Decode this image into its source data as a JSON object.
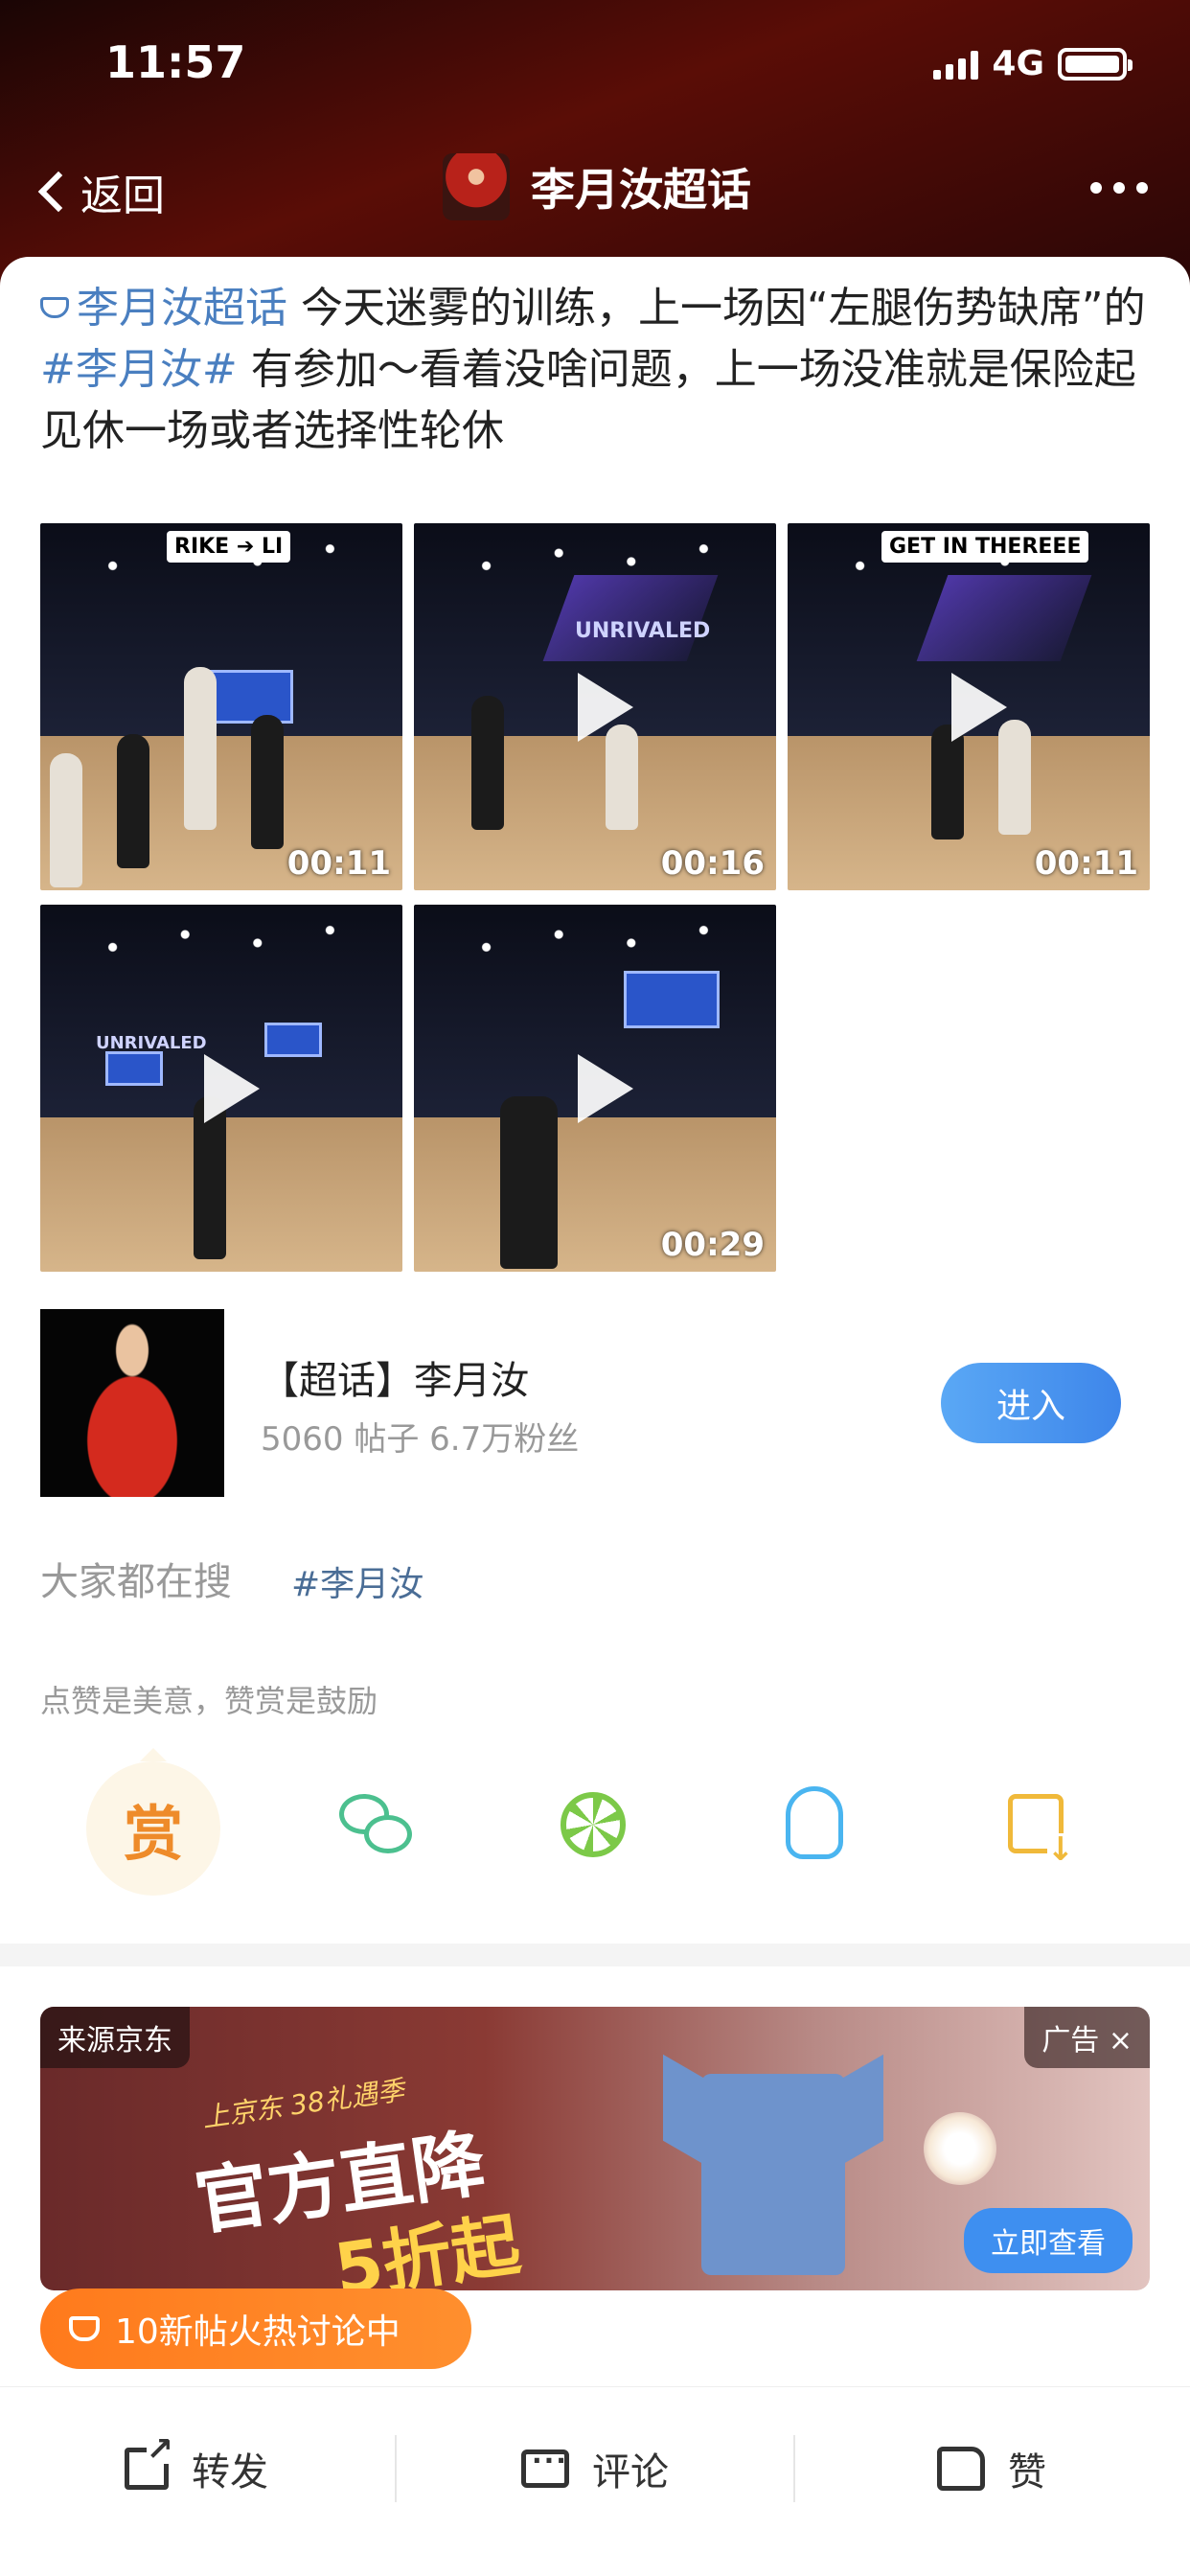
{
  "status_bar": {
    "time": "11:57",
    "network": "4G"
  },
  "nav": {
    "back_label": "返回",
    "title": "李月汝超话"
  },
  "post": {
    "topic_link": "李月汝超话",
    "text_part1": " 今天迷雾的训练，上一场因“左腿伤势缺席”的",
    "hashtag": "#李月汝#",
    "text_part2": " 有参加～看着没啥问题，上一场没准就是保险起见休一场或者选择性轮休"
  },
  "videos": [
    {
      "duration": "00:11",
      "overlay_tag": "RIKE ➔ LI"
    },
    {
      "duration": "00:16",
      "overlay_tag": "UNRIVALED"
    },
    {
      "duration": "00:11",
      "overlay_tag": "GET IN THEREEE"
    },
    {
      "duration": "",
      "overlay_tag": "UNRIVALED"
    },
    {
      "duration": "00:29",
      "overlay_tag": ""
    }
  ],
  "super_topic": {
    "title": "【超话】李月汝",
    "meta": "5060 帖子 6.7万粉丝",
    "enter_label": "进入"
  },
  "search": {
    "label": "大家都在搜",
    "tag": "#李月汝"
  },
  "reward": {
    "hint": "点赞是美意，赞赏是鼓励",
    "button": "赏"
  },
  "share_icons": [
    "reward-icon",
    "wechat-icon",
    "moments-icon",
    "qq-icon",
    "save-image-icon"
  ],
  "ad": {
    "source": "来源京东",
    "label": "广告 ×",
    "slogan_small": "上京东 38礼遇季",
    "slogan_big": "官方直降",
    "slogan_sub": "5折起",
    "cta": "立即查看"
  },
  "hot_pill": {
    "label": "10新帖火热讨论中"
  },
  "bottom_bar": {
    "repost": "转发",
    "comment": "评论",
    "like": "赞"
  },
  "colors": {
    "topic_blue": "#4a7fc0",
    "enter_blue": "#3e86ea",
    "hot_orange": "#ff7a1c",
    "reward_orange": "#ee8b2a"
  }
}
